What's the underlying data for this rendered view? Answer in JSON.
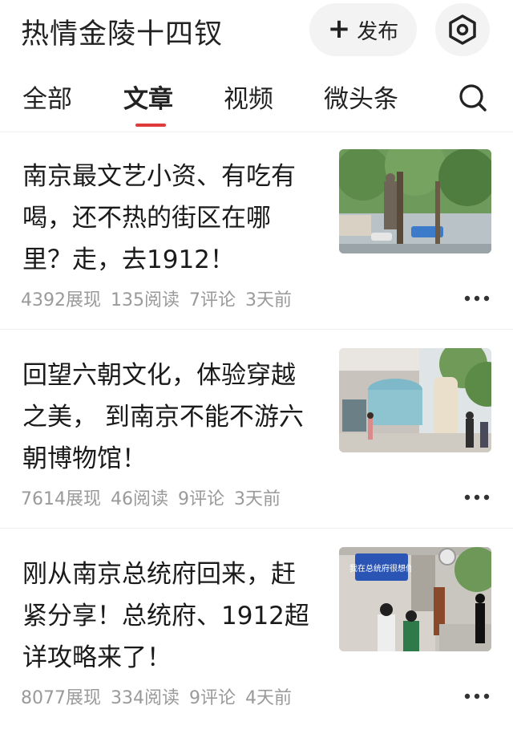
{
  "header": {
    "title": "热情金陵十四钗",
    "publish_label": "发布",
    "publish_icon": "plus-icon",
    "settings_icon": "hexagon-settings-icon"
  },
  "tabs": [
    {
      "label": "全部",
      "active": false
    },
    {
      "label": "文章",
      "active": true
    },
    {
      "label": "视频",
      "active": false
    },
    {
      "label": "微头条",
      "active": false
    }
  ],
  "search_icon": "search-icon",
  "accent_color": "#e03b3b",
  "articles": [
    {
      "title": "南京最文艺小资、有吃有喝，还不热的街区在哪里？走，去1912！",
      "views": "4392展现",
      "reads": "135阅读",
      "comments": "7评论",
      "time": "3天前",
      "thumbnail": "street-trees-statue-photo"
    },
    {
      "title": "回望六朝文化，体验穿越之美， 到南京不能不游六朝博物馆！",
      "views": "7614展现",
      "reads": "46阅读",
      "comments": "9评论",
      "time": "3天前",
      "thumbnail": "museum-building-photo"
    },
    {
      "title": "刚从南京总统府回来，赶紧分享！总统府、1912超详攻略来了！",
      "views": "8077展现",
      "reads": "334阅读",
      "comments": "9评论",
      "time": "4天前",
      "thumbnail": "presidential-palace-entrance-photo",
      "sign_text": "我在总统府很想你"
    }
  ]
}
